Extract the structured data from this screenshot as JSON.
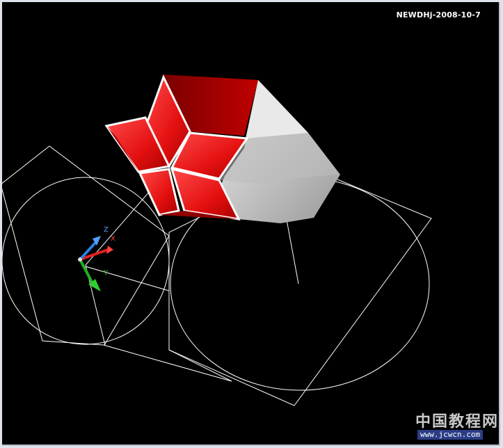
{
  "viewport": {
    "background": "#000000",
    "stamp": "NEWDHj-2008-10-7"
  },
  "ucs": {
    "x_label": "X",
    "y_label": "Y",
    "z_label": "Z",
    "x_color": "#e02020",
    "y_color": "#1fb01f",
    "z_color": "#2a7fe0"
  },
  "model": {
    "solid_color": "#e31212",
    "solid_shadow": "#8a0000",
    "wire_color": "#ffffff",
    "gray_face": "#d8d8d8"
  },
  "watermark": {
    "site_name": "中国教程网",
    "url": "www.jcwcn.com"
  }
}
